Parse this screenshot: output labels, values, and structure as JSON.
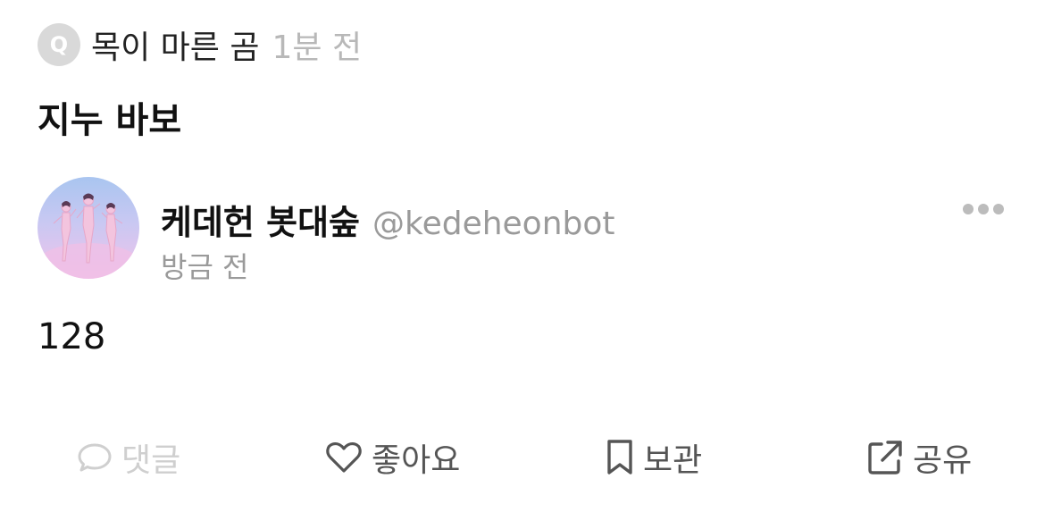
{
  "question": {
    "badge": "Q",
    "asker": "목이 마른 곰",
    "time": "1분 전",
    "text": "지누 바보"
  },
  "answer": {
    "author_name": "케데헌 봇대숲",
    "author_handle": "@kedeheonbot",
    "time": "방금 전",
    "text": "128"
  },
  "actions": {
    "comment": "댓글",
    "like": "좋아요",
    "save": "보관",
    "share": "공유"
  },
  "icons": {
    "badge": "q-badge-icon",
    "more": "more-dots-icon",
    "comment": "speech-bubble-icon",
    "like": "heart-icon",
    "save": "bookmark-icon",
    "share": "external-share-icon"
  },
  "colors": {
    "disabled": "#cfcfcf",
    "secondary": "#9a9a9a",
    "icon": "#555555",
    "badge_bg": "#d9d9d9"
  }
}
